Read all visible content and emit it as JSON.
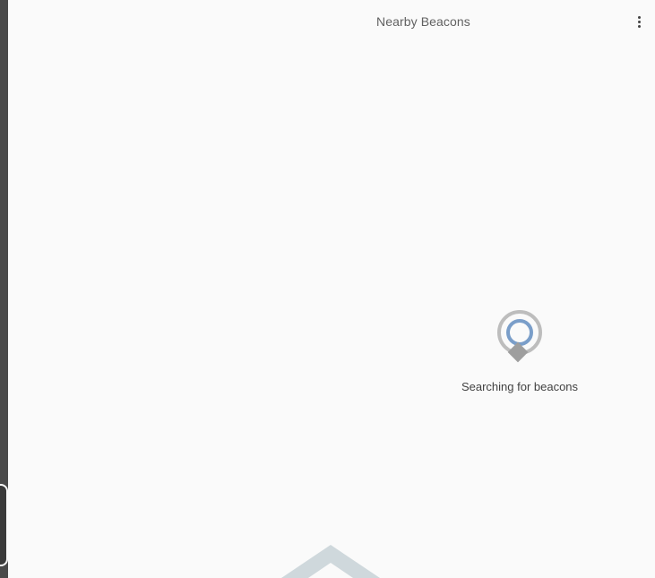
{
  "app_bar": {
    "title": "Nearby Beacons",
    "menu_icon": "more-vert-icon"
  },
  "status": {
    "message": "Searching for beacons",
    "icon": "beacon-searching-icon"
  },
  "bottom": {
    "icon": "chevron-up-icon"
  },
  "colors": {
    "background": "#fafafa",
    "title_text": "#616161",
    "status_text": "#424242",
    "beacon_ring_outer": "#bdbdbd",
    "beacon_ring_inner": "#7a9ec9",
    "beacon_marker": "#9e9e9e",
    "chevron": "#cfd8dc",
    "left_edge": "#4a4a4a"
  }
}
